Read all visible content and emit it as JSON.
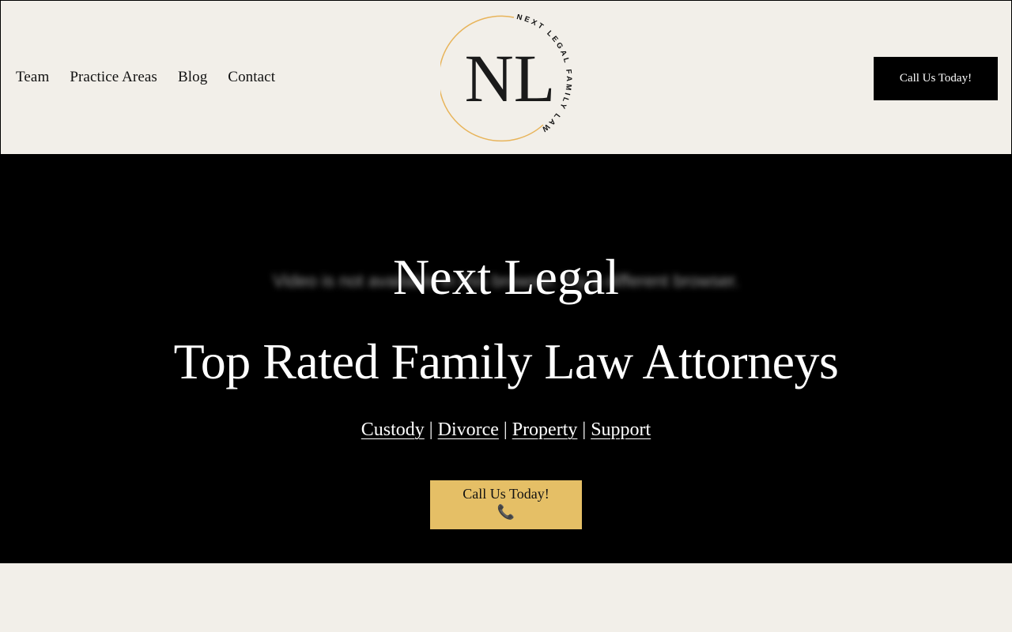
{
  "nav": {
    "items": [
      {
        "label": "Team"
      },
      {
        "label": "Practice Areas"
      },
      {
        "label": "Blog"
      },
      {
        "label": "Contact"
      }
    ]
  },
  "logo": {
    "initials": "NL",
    "ring_text": "NEXT LEGAL FAMILY LAW",
    "ring_color": "#e8b45a"
  },
  "header": {
    "call_button": "Call Us Today!"
  },
  "hero": {
    "video_message": "Video is not available in this browser. Try a different browser.",
    "title": "Next Legal",
    "subtitle": "Top Rated Family Law Attorneys",
    "links": [
      {
        "label": "Custody"
      },
      {
        "label": "Divorce"
      },
      {
        "label": "Property"
      },
      {
        "label": "Support"
      }
    ],
    "separator": "|",
    "cta_label": "Call Us Today!",
    "cta_icon": "phone-icon",
    "cta_color": "#e5bf66"
  }
}
